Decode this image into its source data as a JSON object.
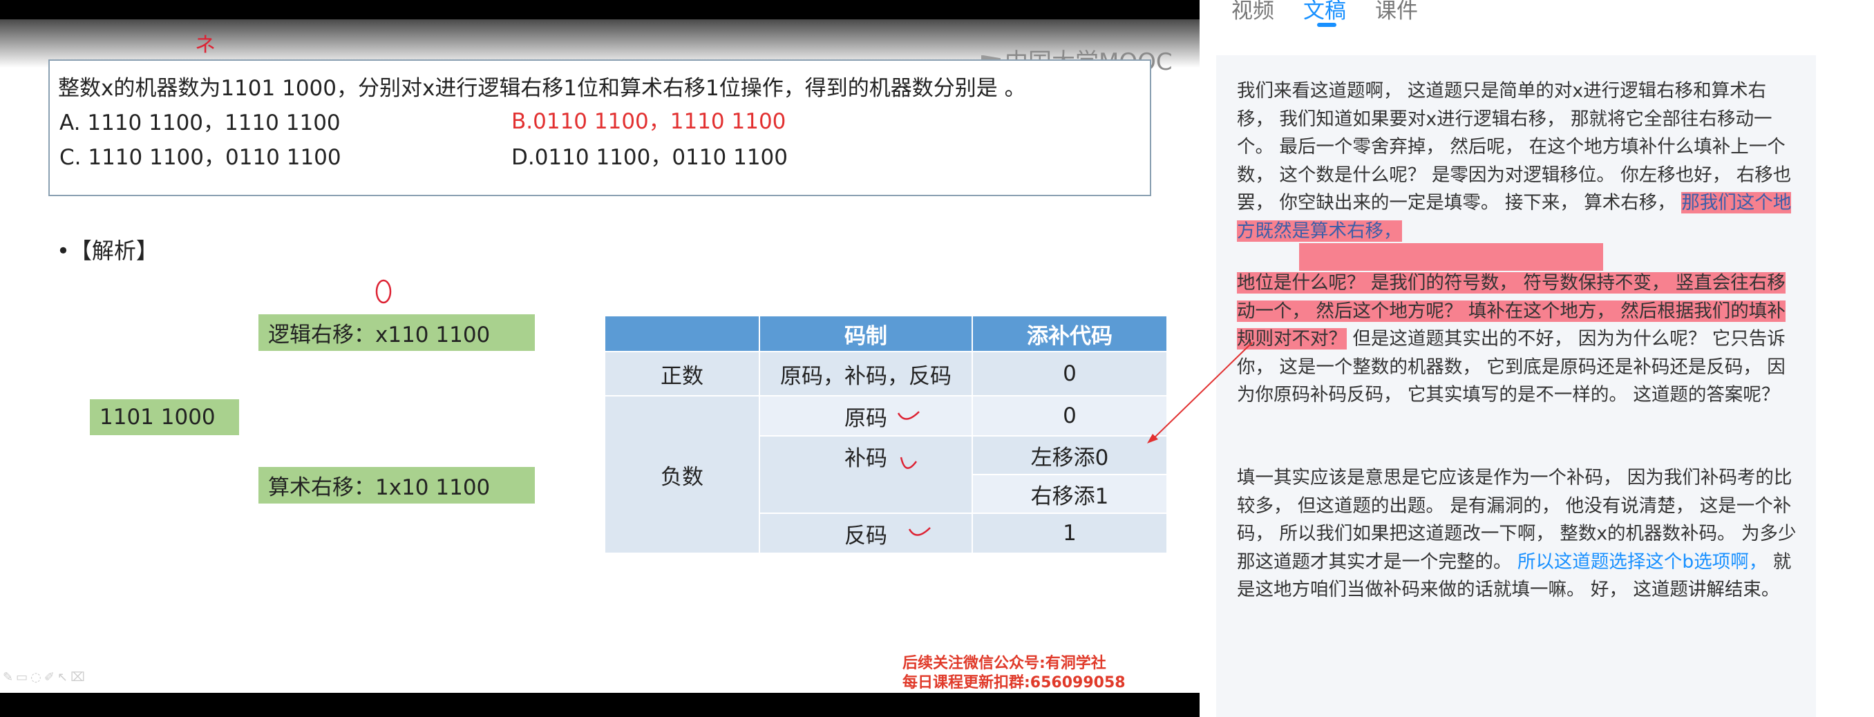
{
  "watermark": "中国大学MOOC",
  "question": {
    "text": "整数x的机器数为1101 1000，分别对x进行逻辑右移1位和算术右移1位操作，得到的机器数分别是      。",
    "options": {
      "a": "A. 1110 1100，1110 1100",
      "b": "B.0110 1100，1110 1100",
      "c": "C. 1110 1100，0110 1100",
      "d": "D.0110 1100，0110 1100"
    }
  },
  "analysis_label": "•【解析】",
  "diagram": {
    "logic_shift": "逻辑右移：x110 1100",
    "source": "1101 1000",
    "arith_shift": "算术右移：1x10 1100"
  },
  "table": {
    "headers": [
      "",
      "码制",
      "添补代码"
    ],
    "positive": {
      "label": "正数",
      "codes": "原码，补码，反码",
      "fill": "0"
    },
    "negative": {
      "label": "负数",
      "rows": [
        {
          "code": "原码",
          "fill": "0"
        },
        {
          "code": "补码",
          "fill_left": "左移添0",
          "fill_right": "右移添1"
        },
        {
          "code": "反码",
          "fill": "1"
        }
      ]
    }
  },
  "promo": {
    "line1": "后续关注微信公众号:有洞学社",
    "line2": "每日课程更新扣群:656099058"
  },
  "tabs": [
    "视频",
    "文稿",
    "课件"
  ],
  "transcript": {
    "p1a": "我们来看这道题啊， 这道题只是简单的对x进行逻辑右移和算术右移， 我们知道如果要对x进行逻辑右移， 那就将它全部往右移动一个。 最后一个零舍弃掉， 然后呢， 在这个地方填补什么填补上一个数， 这个数是什么呢？ 是零因为对逻辑移位。 你左移也好， 右移也罢， 你空缺出来的一定是填零。 接下来， 算术右移，",
    "p1b": "那我们这个地方既然是算术右移，",
    "p2a": "地位是什么呢？ 是我们的符号数， 符号数保持不变， 竖直会往右移动一个， 然后这个地方呢？ 填补在这个地方， 然后根据我们的填补规则对不对？",
    "p2b": "但是这道题其实出的不好， 因为为什么呢？ 它只告诉你， 这是一个整数的机器数， 它到底是原码还是补码还是反码， 因为你原码补码反码， 它其实填写的是不一样的。 这道题的答案呢？",
    "p3a": "填一其实应该是意思是它应该是作为一个补码， 因为我们补码考的比较多， 但这道题的出题。 是有漏洞的， 他没有说清楚， 这是一个补码， 所以我们如果把这道题改一下啊， 整数x的机器数补码。 为多少那这道题才其实才是一个完整的。",
    "p3b": "所以这道题选择这个b选项啊，",
    "p3c": "就是这地方咱们当做补码来做的话就填一嘛。 好， 这道题讲解结束。"
  },
  "colors": {
    "accent": "#1890ff",
    "highlight": "#f7818f",
    "green": "#a9d18e",
    "table_header": "#5b9bd5"
  }
}
